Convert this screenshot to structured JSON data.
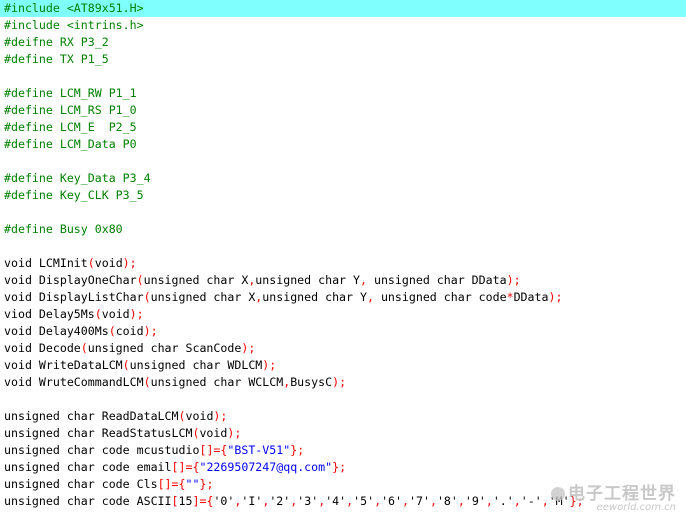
{
  "colors": {
    "current_line_bg": "#80ffff",
    "preprocessor": "#008000",
    "punctuation": "#ff0000",
    "string": "#0000ff",
    "text": "#000000"
  },
  "current_line_index": 0,
  "lines": [
    {
      "kind": "pp",
      "text": "#include <AT89x51.H>"
    },
    {
      "kind": "pp",
      "text": "#include <intrins.h>"
    },
    {
      "kind": "pp",
      "text": "#deifne RX P3_2"
    },
    {
      "kind": "pp",
      "text": "#define TX P1_5"
    },
    {
      "kind": "blank",
      "text": ""
    },
    {
      "kind": "pp",
      "text": "#define LCM_RW P1_1"
    },
    {
      "kind": "pp",
      "text": "#define LCM_RS P1_0"
    },
    {
      "kind": "pp",
      "text": "#define LCM_E  P2_5"
    },
    {
      "kind": "pp",
      "text": "#define LCM_Data P0"
    },
    {
      "kind": "blank",
      "text": ""
    },
    {
      "kind": "pp",
      "text": "#define Key_Data P3_4"
    },
    {
      "kind": "pp",
      "text": "#define Key_CLK P3_5"
    },
    {
      "kind": "blank",
      "text": ""
    },
    {
      "kind": "pp",
      "text": "#define Busy 0x80"
    },
    {
      "kind": "blank",
      "text": ""
    },
    {
      "kind": "code",
      "text": "void LCMInit(void);"
    },
    {
      "kind": "code",
      "text": "void DisplayOneChar(unsigned char X,unsigned char Y, unsigned char DData);"
    },
    {
      "kind": "code",
      "text": "void DisplayListChar(unsigned char X,unsigned char Y, unsigned char code*DData);"
    },
    {
      "kind": "code",
      "text": "viod Delay5Ms(void);"
    },
    {
      "kind": "code",
      "text": "void Delay400Ms(coid);"
    },
    {
      "kind": "code",
      "text": "void Decode(unsigned char ScanCode);"
    },
    {
      "kind": "code",
      "text": "void WriteDataLCM(unsigned char WDLCM);"
    },
    {
      "kind": "code",
      "text": "void WruteCommandLCM(unsigned char WCLCM,BusysC);"
    },
    {
      "kind": "blank",
      "text": ""
    },
    {
      "kind": "code",
      "text": "unsigned char ReadDataLCM(void);"
    },
    {
      "kind": "code",
      "text": "unsigned char ReadStatusLCM(void);"
    },
    {
      "kind": "code",
      "text": "unsigned char code mcustudio[]={\"BST-V51\"};"
    },
    {
      "kind": "code",
      "text": "unsigned char code email[]={\"2269507247@qq.com\"};"
    },
    {
      "kind": "code",
      "text": "unsigned char code Cls[]={\"\"};"
    },
    {
      "kind": "code",
      "text": "unsigned char code ASCII[15]={'0','I','2','3','4','5','6','7','8','9','.','-','M'};"
    }
  ],
  "watermark": {
    "cn": "电子工程世界",
    "en": "eeworld.com.cn"
  }
}
